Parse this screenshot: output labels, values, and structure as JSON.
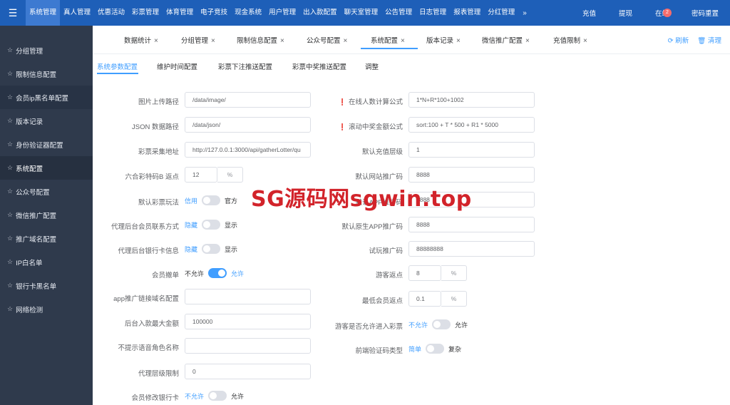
{
  "topnav": {
    "items": [
      "系统管理",
      "真人管理",
      "优惠活动",
      "彩票管理",
      "体育管理",
      "电子竞技",
      "现金系统",
      "用户管理",
      "出入款配置",
      "聊天室管理",
      "公告管理",
      "日志管理",
      "报表管理",
      "分红管理"
    ],
    "more": "»",
    "right": {
      "recharge": "充值",
      "withdraw": "提现",
      "online": "在线",
      "online_count": "2",
      "password_reset": "密码重置"
    }
  },
  "sidebar": {
    "items": [
      "分组管理",
      "限制信息配置",
      "会员ip黑名单配置",
      "版本记录",
      "身份验证器配置",
      "系统配置",
      "公众号配置",
      "微信推广配置",
      "推广域名配置",
      "IP白名单",
      "银行卡黑名单",
      "网络检测"
    ]
  },
  "tabs": {
    "items": [
      "数据统计",
      "分组管理",
      "限制信息配置",
      "公众号配置",
      "系统配置",
      "版本记录",
      "微信推广配置",
      "充值限制"
    ],
    "close": "×",
    "refresh": "刷新",
    "clear": "清理"
  },
  "subtabs": [
    "系统参数配置",
    "维护时间配置",
    "彩票下注推送配置",
    "彩票中奖推送配置",
    "调整"
  ],
  "form_left": {
    "image_path": {
      "label": "图片上传路径",
      "value": "/data/image/"
    },
    "json_path": {
      "label": "JSON 数据路径",
      "value": "/data/json/"
    },
    "lottery_url": {
      "label": "彩票采集地址",
      "value": "http://127.0.0.1:3000/api/gatherLotter/qu"
    },
    "lhc_rebate": {
      "label": "六合彩特码B 返点",
      "value": "12",
      "suffix": "%"
    },
    "default_lottery_play": {
      "label": "默认彩票玩法",
      "left": "信用",
      "right": "官方"
    },
    "agent_contact": {
      "label": "代理后台会员联系方式",
      "left": "隐藏",
      "right": "显示"
    },
    "agent_bank": {
      "label": "代理后台银行卡信息",
      "left": "隐藏",
      "right": "显示"
    },
    "member_withdraw": {
      "label": "会员撤单",
      "left": "不允许",
      "right": "允许"
    },
    "app_domain": {
      "label": "app推广链接域名配置",
      "value": ""
    },
    "max_deposit": {
      "label": "后台入款最大金额",
      "value": "100000"
    },
    "no_voice_role": {
      "label": "不提示语音角色名称",
      "value": ""
    },
    "agent_level_limit": {
      "label": "代理层级限制",
      "value": "0"
    },
    "member_edit_bank": {
      "label": "会员修改银行卡",
      "left": "不允许",
      "right": "允许"
    }
  },
  "form_right": {
    "online_formula": {
      "label": "在线人数计算公式",
      "value": "1*N+R*100+1002"
    },
    "scroll_formula": {
      "label": "滚动中奖金额公式",
      "value": "sort:100 + T * 500 + R1 * 5000"
    },
    "default_level": {
      "label": "默认充值层级",
      "value": "1"
    },
    "default_site_code": {
      "label": "默认网站推广码",
      "value": "8888"
    },
    "default_app_code_hidden": {
      "label": "默认APP推广码",
      "value": "8888"
    },
    "default_native_code": {
      "label": "默认原生APP推广码",
      "value": "8888"
    },
    "trial_code": {
      "label": "试玩推广码",
      "value": "88888888"
    },
    "guest_rebate": {
      "label": "游客返点",
      "value": "8",
      "suffix": "%"
    },
    "min_member_rebate": {
      "label": "最低会员返点",
      "value": "0.1",
      "suffix": "%"
    },
    "guest_lottery": {
      "label": "游客是否允许进入彩票",
      "left": "不允许",
      "right": "允许"
    },
    "captcha_type": {
      "label": "前端验证码类型",
      "left": "简单",
      "right": "复杂"
    }
  },
  "watermark": "SG源码网sgwin.top",
  "colors": {
    "topbar": "#1e5fb8",
    "sidebar": "#2f3a4c",
    "accent": "#409eff",
    "required": "#f56c6c",
    "watermark": "#d2232a"
  }
}
